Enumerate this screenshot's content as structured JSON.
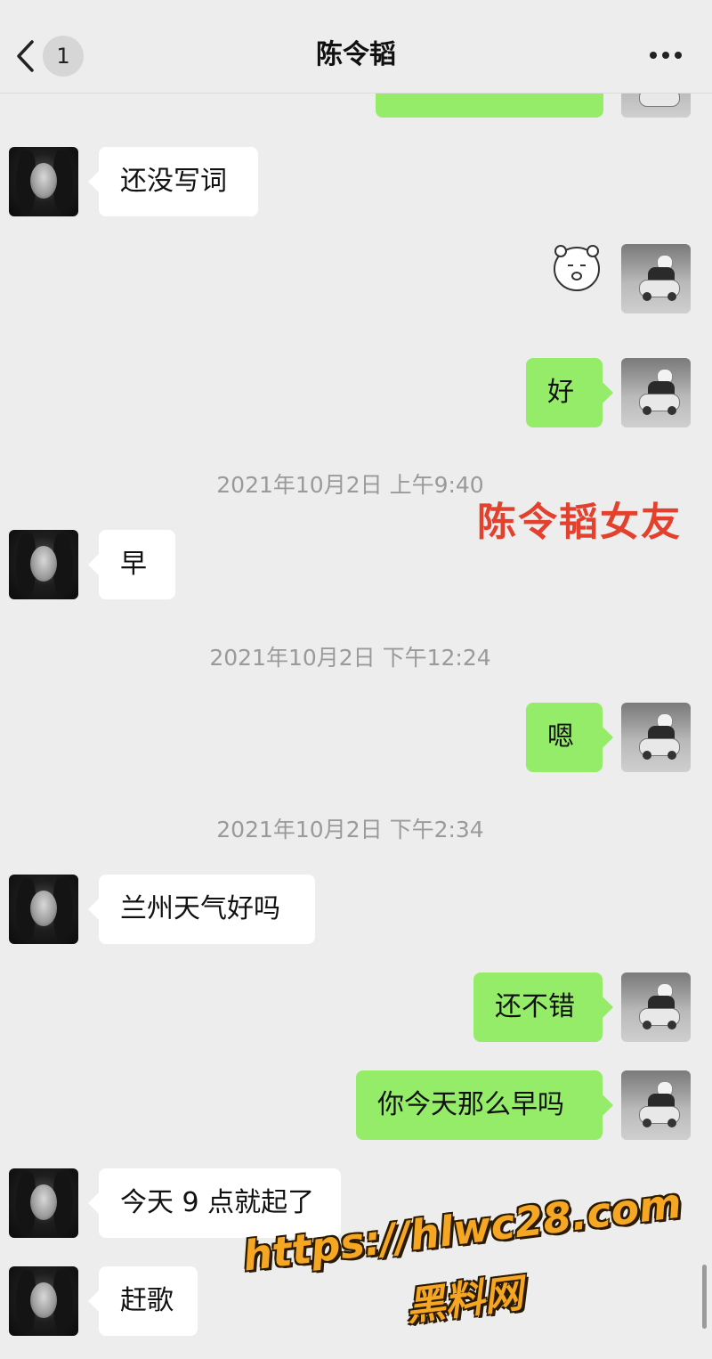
{
  "header": {
    "unread_count": "1",
    "title": "陈令韬"
  },
  "messages": {
    "m1": "还没写词",
    "m2": "好",
    "m3": "早",
    "m4": "嗯",
    "m5": "兰州天气好吗",
    "m6": "还不错",
    "m7": "你今天那么早吗",
    "m8": "今天 9 点就起了",
    "m9": "赶歌"
  },
  "timestamps": {
    "t1": "2021年10月2日 上午9:40",
    "t2": "2021年10月2日 下午12:24",
    "t3": "2021年10月2日 下午2:34"
  },
  "overlays": {
    "caption": "陈令韬女友",
    "watermark_url": "https://hlwc28.com",
    "watermark_name": "黑料网"
  },
  "icons": {
    "back": "chevron-left-icon",
    "more": "more-dots-icon",
    "sticker": "bear-face-sticker"
  },
  "colors": {
    "background": "#ededed",
    "sent_bubble": "#95ec69",
    "received_bubble": "#ffffff",
    "caption": "#e3402d",
    "watermark": "#f5a623"
  }
}
